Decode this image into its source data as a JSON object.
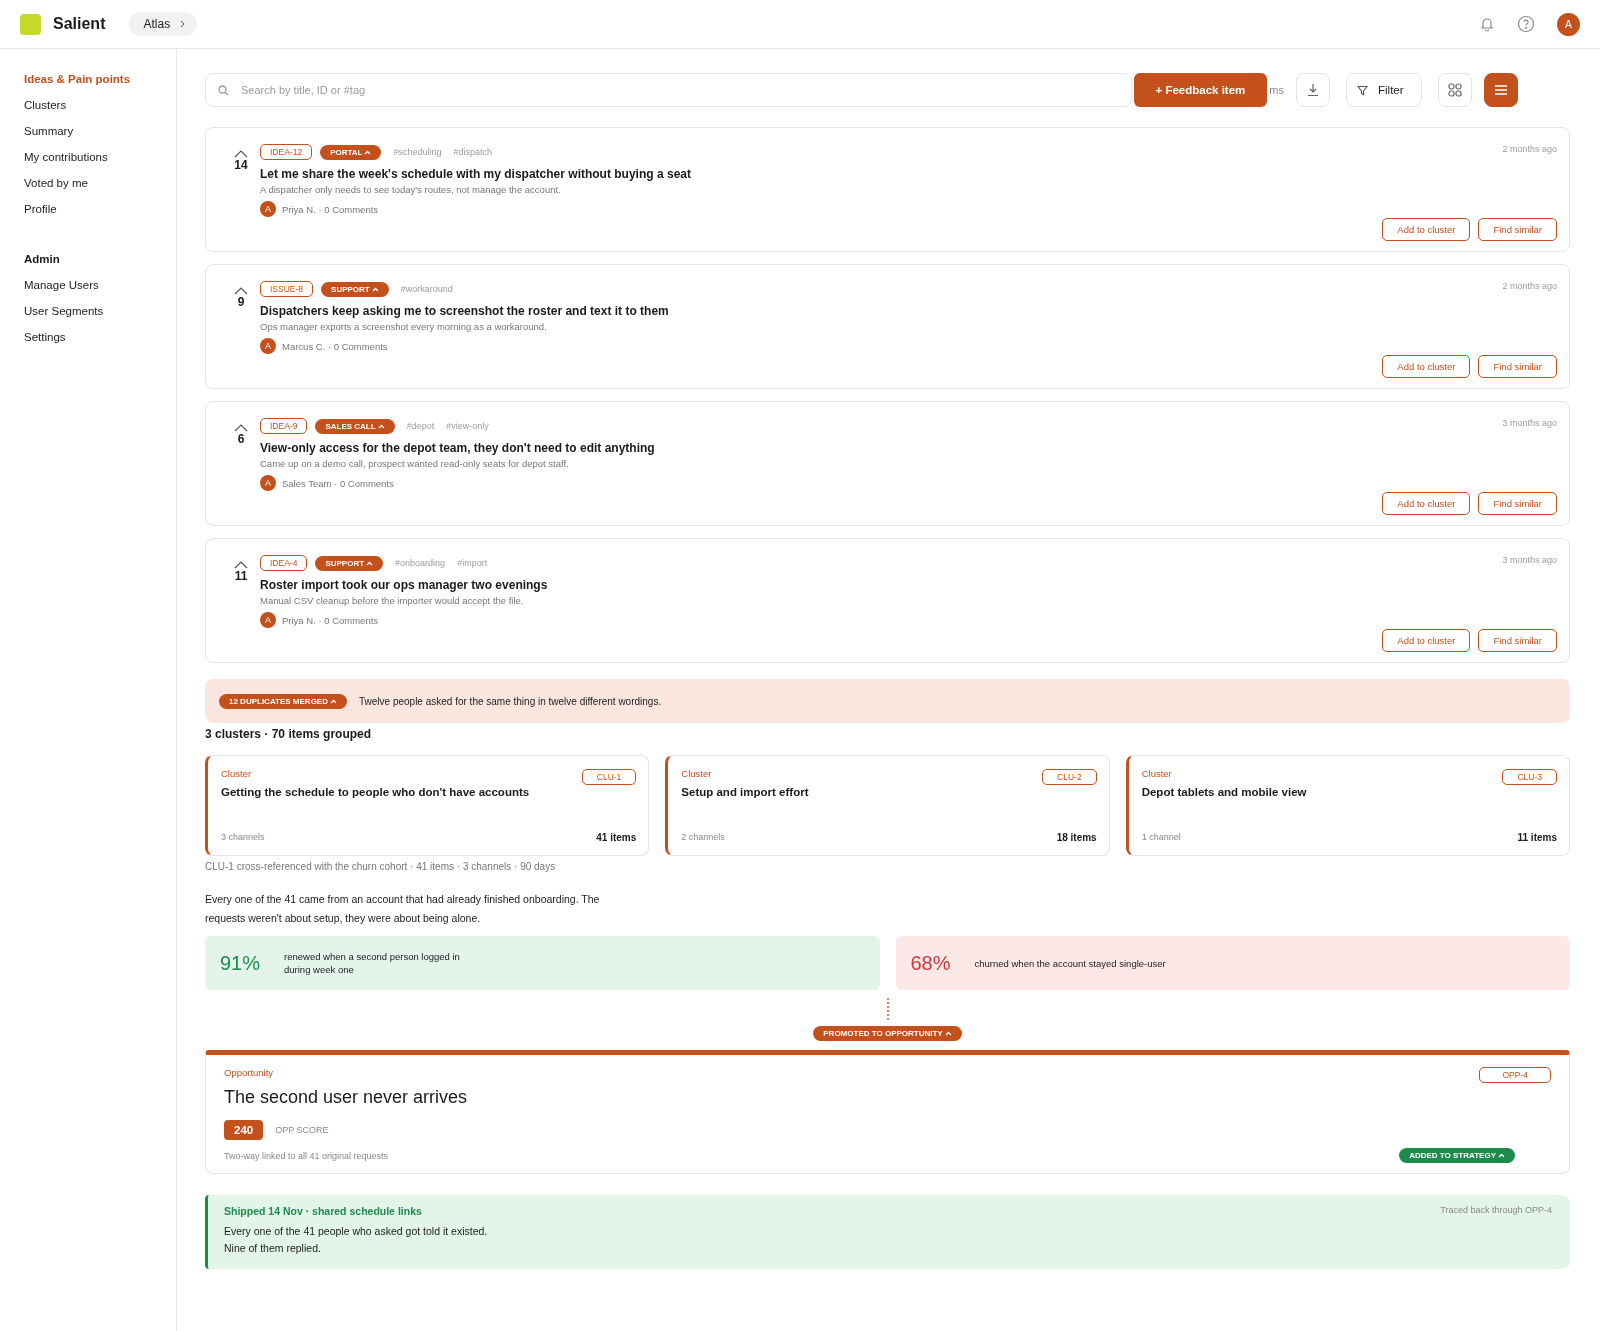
{
  "header": {
    "brand": "Salient",
    "workspace": "Atlas",
    "avatar": "A"
  },
  "sidebar": {
    "items": [
      {
        "label": "Ideas & Pain points",
        "selected": true
      },
      {
        "label": "Clusters",
        "selected": false
      },
      {
        "label": "Summary",
        "selected": false
      },
      {
        "label": "My contributions",
        "selected": false
      },
      {
        "label": "Voted by me",
        "selected": false
      },
      {
        "label": "Profile",
        "selected": false
      }
    ],
    "admin_title": "Admin",
    "admin_items": [
      {
        "label": "Manage Users",
        "selected": false
      },
      {
        "label": "User Segments",
        "selected": false
      },
      {
        "label": "Settings",
        "selected": false
      }
    ]
  },
  "toolbar": {
    "search_placeholder": "Search by title, ID or #tag",
    "hidden_text": "ms",
    "add_button": "+ Feedback item",
    "filter": "Filter",
    "list_view_selected": true
  },
  "items": [
    {
      "votes": "14",
      "id": "IDEA-12",
      "source": "PORTAL",
      "tags": [
        "#scheduling",
        "#dispatch"
      ],
      "title": "Let me share the week's schedule with my dispatcher without buying a seat",
      "description": "A dispatcher only needs to see today's routes, not manage the account.",
      "avatar": "A",
      "meta": "Priya N. · 0 Comments",
      "time": "2 months ago",
      "actions": [
        "Add to cluster",
        "Find similar"
      ]
    },
    {
      "votes": "9",
      "id": "ISSUE-8",
      "source": "SUPPORT",
      "tags": [
        "#workaround"
      ],
      "title": "Dispatchers keep asking me to screenshot the roster and text it to them",
      "description": "Ops manager exports a screenshot every morning as a workaround.",
      "avatar": "A",
      "meta": "Marcus C. · 0 Comments",
      "time": "2 months ago",
      "actions": [
        "Add to cluster",
        "Find similar"
      ]
    },
    {
      "votes": "6",
      "id": "IDEA-9",
      "source": "SALES CALL",
      "tags": [
        "#depot",
        "#view-only"
      ],
      "title": "View-only access for the depot team, they don't need to edit anything",
      "description": "Came up on a demo call, prospect wanted read-only seats for depot staff.",
      "avatar": "A",
      "meta": "Sales Team · 0 Comments",
      "time": "3 months ago",
      "actions": [
        "Add to cluster",
        "Find similar"
      ]
    },
    {
      "votes": "11",
      "id": "IDEA-4",
      "source": "SUPPORT",
      "tags": [
        "#onboarding",
        "#import"
      ],
      "title": "Roster import took our ops manager two evenings",
      "description": "Manual CSV cleanup before the importer would accept the file.",
      "avatar": "A",
      "meta": "Priya N. · 0 Comments",
      "time": "3 months ago",
      "actions": [
        "Add to cluster",
        "Find similar"
      ]
    }
  ],
  "merge_banner": {
    "badge": "12 DUPLICATES MERGED",
    "text": "Twelve people asked for the same thing in twelve different wordings."
  },
  "clusters_heading": "3 clusters · 70 items grouped",
  "clusters": [
    {
      "label": "Cluster",
      "id": "CLU-1",
      "title": "Getting the schedule to people who don't have accounts",
      "channels": "3 channels",
      "count": "41 items"
    },
    {
      "label": "Cluster",
      "id": "CLU-2",
      "title": "Setup and import effort",
      "channels": "2 channels",
      "count": "18 items"
    },
    {
      "label": "Cluster",
      "id": "CLU-3",
      "title": "Depot tablets and mobile view",
      "channels": "1 channel",
      "count": "11 items"
    }
  ],
  "cross_reference": "CLU-1 cross-referenced with the churn cohort · 41 items · 3 channels · 90 days",
  "insight": "Every one of the 41 came from an account that had already finished onboarding. The requests weren't about setup, they were about being alone.",
  "stats": [
    {
      "kind": "positive",
      "value": "91%",
      "text": "renewed when a second person logged in during week one"
    },
    {
      "kind": "negative",
      "value": "68%",
      "text": "churned when the account stayed single-user"
    }
  ],
  "promoted_badge": "PROMOTED TO OPPORTUNITY",
  "opportunity": {
    "label": "Opportunity",
    "id": "OPP-4",
    "title": "The second user never arrives",
    "score": "240",
    "score_label": "OPP SCORE",
    "note": "Two-way linked to all 41 original requests",
    "strategy_badge": "ADDED TO STRATEGY"
  },
  "shipped": {
    "title": "Shipped 14 Nov · shared schedule links",
    "trace": "Traced back through OPP-4",
    "lines": [
      "Every one of the 41 people who asked got told it existed.",
      "Nine of them replied."
    ]
  }
}
